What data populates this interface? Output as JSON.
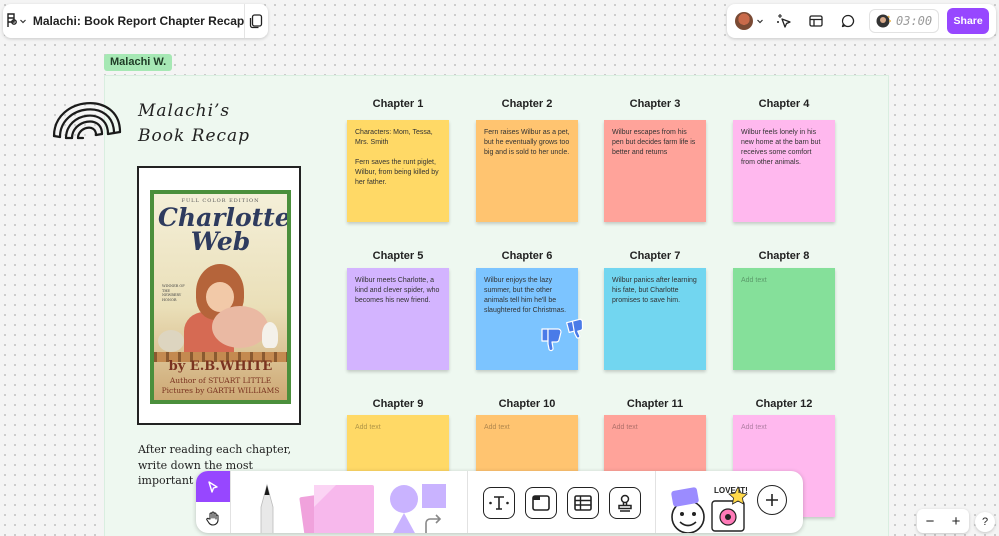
{
  "file": {
    "title": "Malachi: Book Report Chapter Recap"
  },
  "header": {
    "timer": "03:00",
    "share_label": "Share"
  },
  "board": {
    "name_tag": "Malachi W.",
    "title_line1": "Malachi’s",
    "title_line2": "Book Recap",
    "instructions": "After reading each chapter, write down the most important things that happen"
  },
  "book": {
    "edition": "FULL COLOR EDITION",
    "title": "Charlotte's Web",
    "award": "WINNER OF THE NEWBERY HONOR",
    "author": "by E.B.WHITE",
    "author_of": "Author of STUART LITTLE",
    "pictures_by": "Pictures by GARTH WILLIAMS"
  },
  "chapters": [
    {
      "label": "Chapter 1",
      "text": "Characters: Mom, Tessa, Mrs. Smith\n\nFern saves the runt piglet, Wilbur, from being killed by her father.",
      "color": "#ffd966"
    },
    {
      "label": "Chapter 2",
      "text": "Fern raises Wilbur as a pet, but he eventually grows too big and is sold to her uncle.",
      "color": "#ffc470"
    },
    {
      "label": "Chapter 3",
      "text": "Wilbur escapes from his pen but decides farm life is better and returns",
      "color": "#ffa39a"
    },
    {
      "label": "Chapter 4",
      "text": "Wilbur feels lonely in his new home at the barn but receives some comfort from other animals.",
      "color": "#ffb8ee"
    },
    {
      "label": "Chapter 5",
      "text": "Wilbur meets Charlotte, a kind and clever spider, who becomes his new friend.",
      "color": "#d3b4ff"
    },
    {
      "label": "Chapter 6",
      "text": "Wilbur enjoys the lazy summer, but the other animals tell him he'll be slaughtered for Christmas.",
      "color": "#7cc4ff"
    },
    {
      "label": "Chapter 7",
      "text": "Wilbur panics after learning his fate, but Charlotte promises to save him.",
      "color": "#72d6f0"
    },
    {
      "label": "Chapter 8",
      "text": "Add text",
      "color": "#85e09a",
      "empty": true
    },
    {
      "label": "Chapter 9",
      "text": "Add text",
      "color": "#ffd966",
      "empty": true
    },
    {
      "label": "Chapter 10",
      "text": "Add text",
      "color": "#ffc470",
      "empty": true
    },
    {
      "label": "Chapter 11",
      "text": "Add text",
      "color": "#ffa39a",
      "empty": true
    },
    {
      "label": "Chapter 12",
      "text": "Add text",
      "color": "#ffb8ee",
      "empty": true
    }
  ],
  "toolbar": {
    "sticker_text": "LOVE IT!"
  },
  "zoom": {
    "minus": "−",
    "plus": "+",
    "help": "?"
  },
  "colors": {
    "accent": "#9747ff",
    "section_bg": "#eef8f0",
    "name_tag": "#a6e8b4"
  }
}
